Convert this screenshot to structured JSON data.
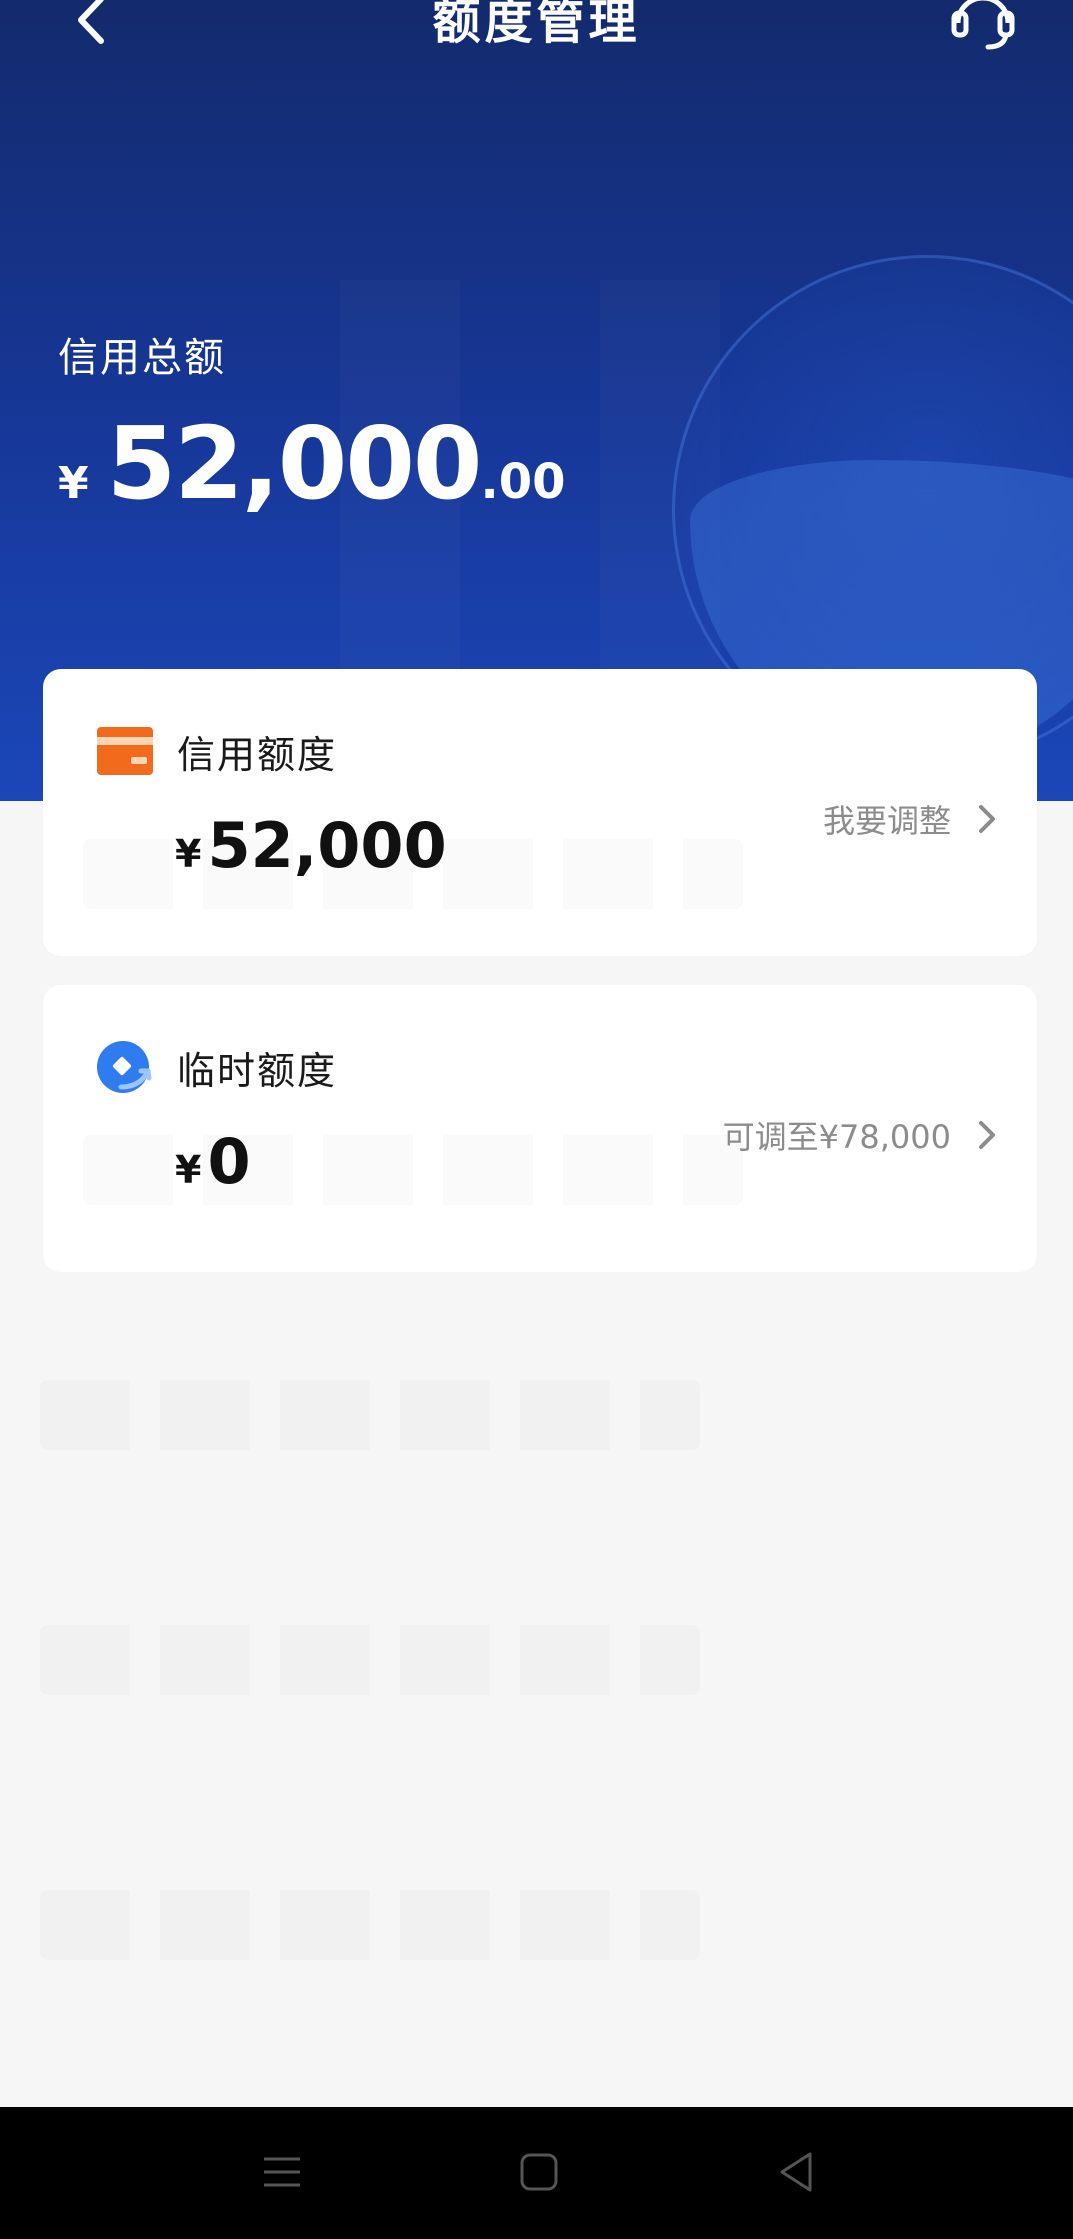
{
  "header": {
    "title": "额度管理",
    "back_icon": "back-arrow-icon",
    "service_icon": "customer-service-headset-icon"
  },
  "total": {
    "label": "信用总额",
    "currency": "¥",
    "integer": "52,000",
    "decimal": ".00"
  },
  "cards": {
    "credit": {
      "icon": "credit-card-icon",
      "title": "信用额度",
      "currency": "¥",
      "amount": "52,000",
      "action": "我要调整"
    },
    "temporary": {
      "icon": "temporary-limit-icon",
      "title": "临时额度",
      "currency": "¥",
      "amount": "0",
      "action": "可调至¥78,000"
    }
  },
  "navbar": {
    "items": [
      "menu-icon",
      "home-square-icon",
      "back-triangle-icon"
    ]
  },
  "colors": {
    "hero_top": "#132a6c",
    "hero_bottom": "#1b47b8",
    "card_icon_orange": "#f26b1d",
    "card_icon_blue": "#2f7bf0"
  }
}
